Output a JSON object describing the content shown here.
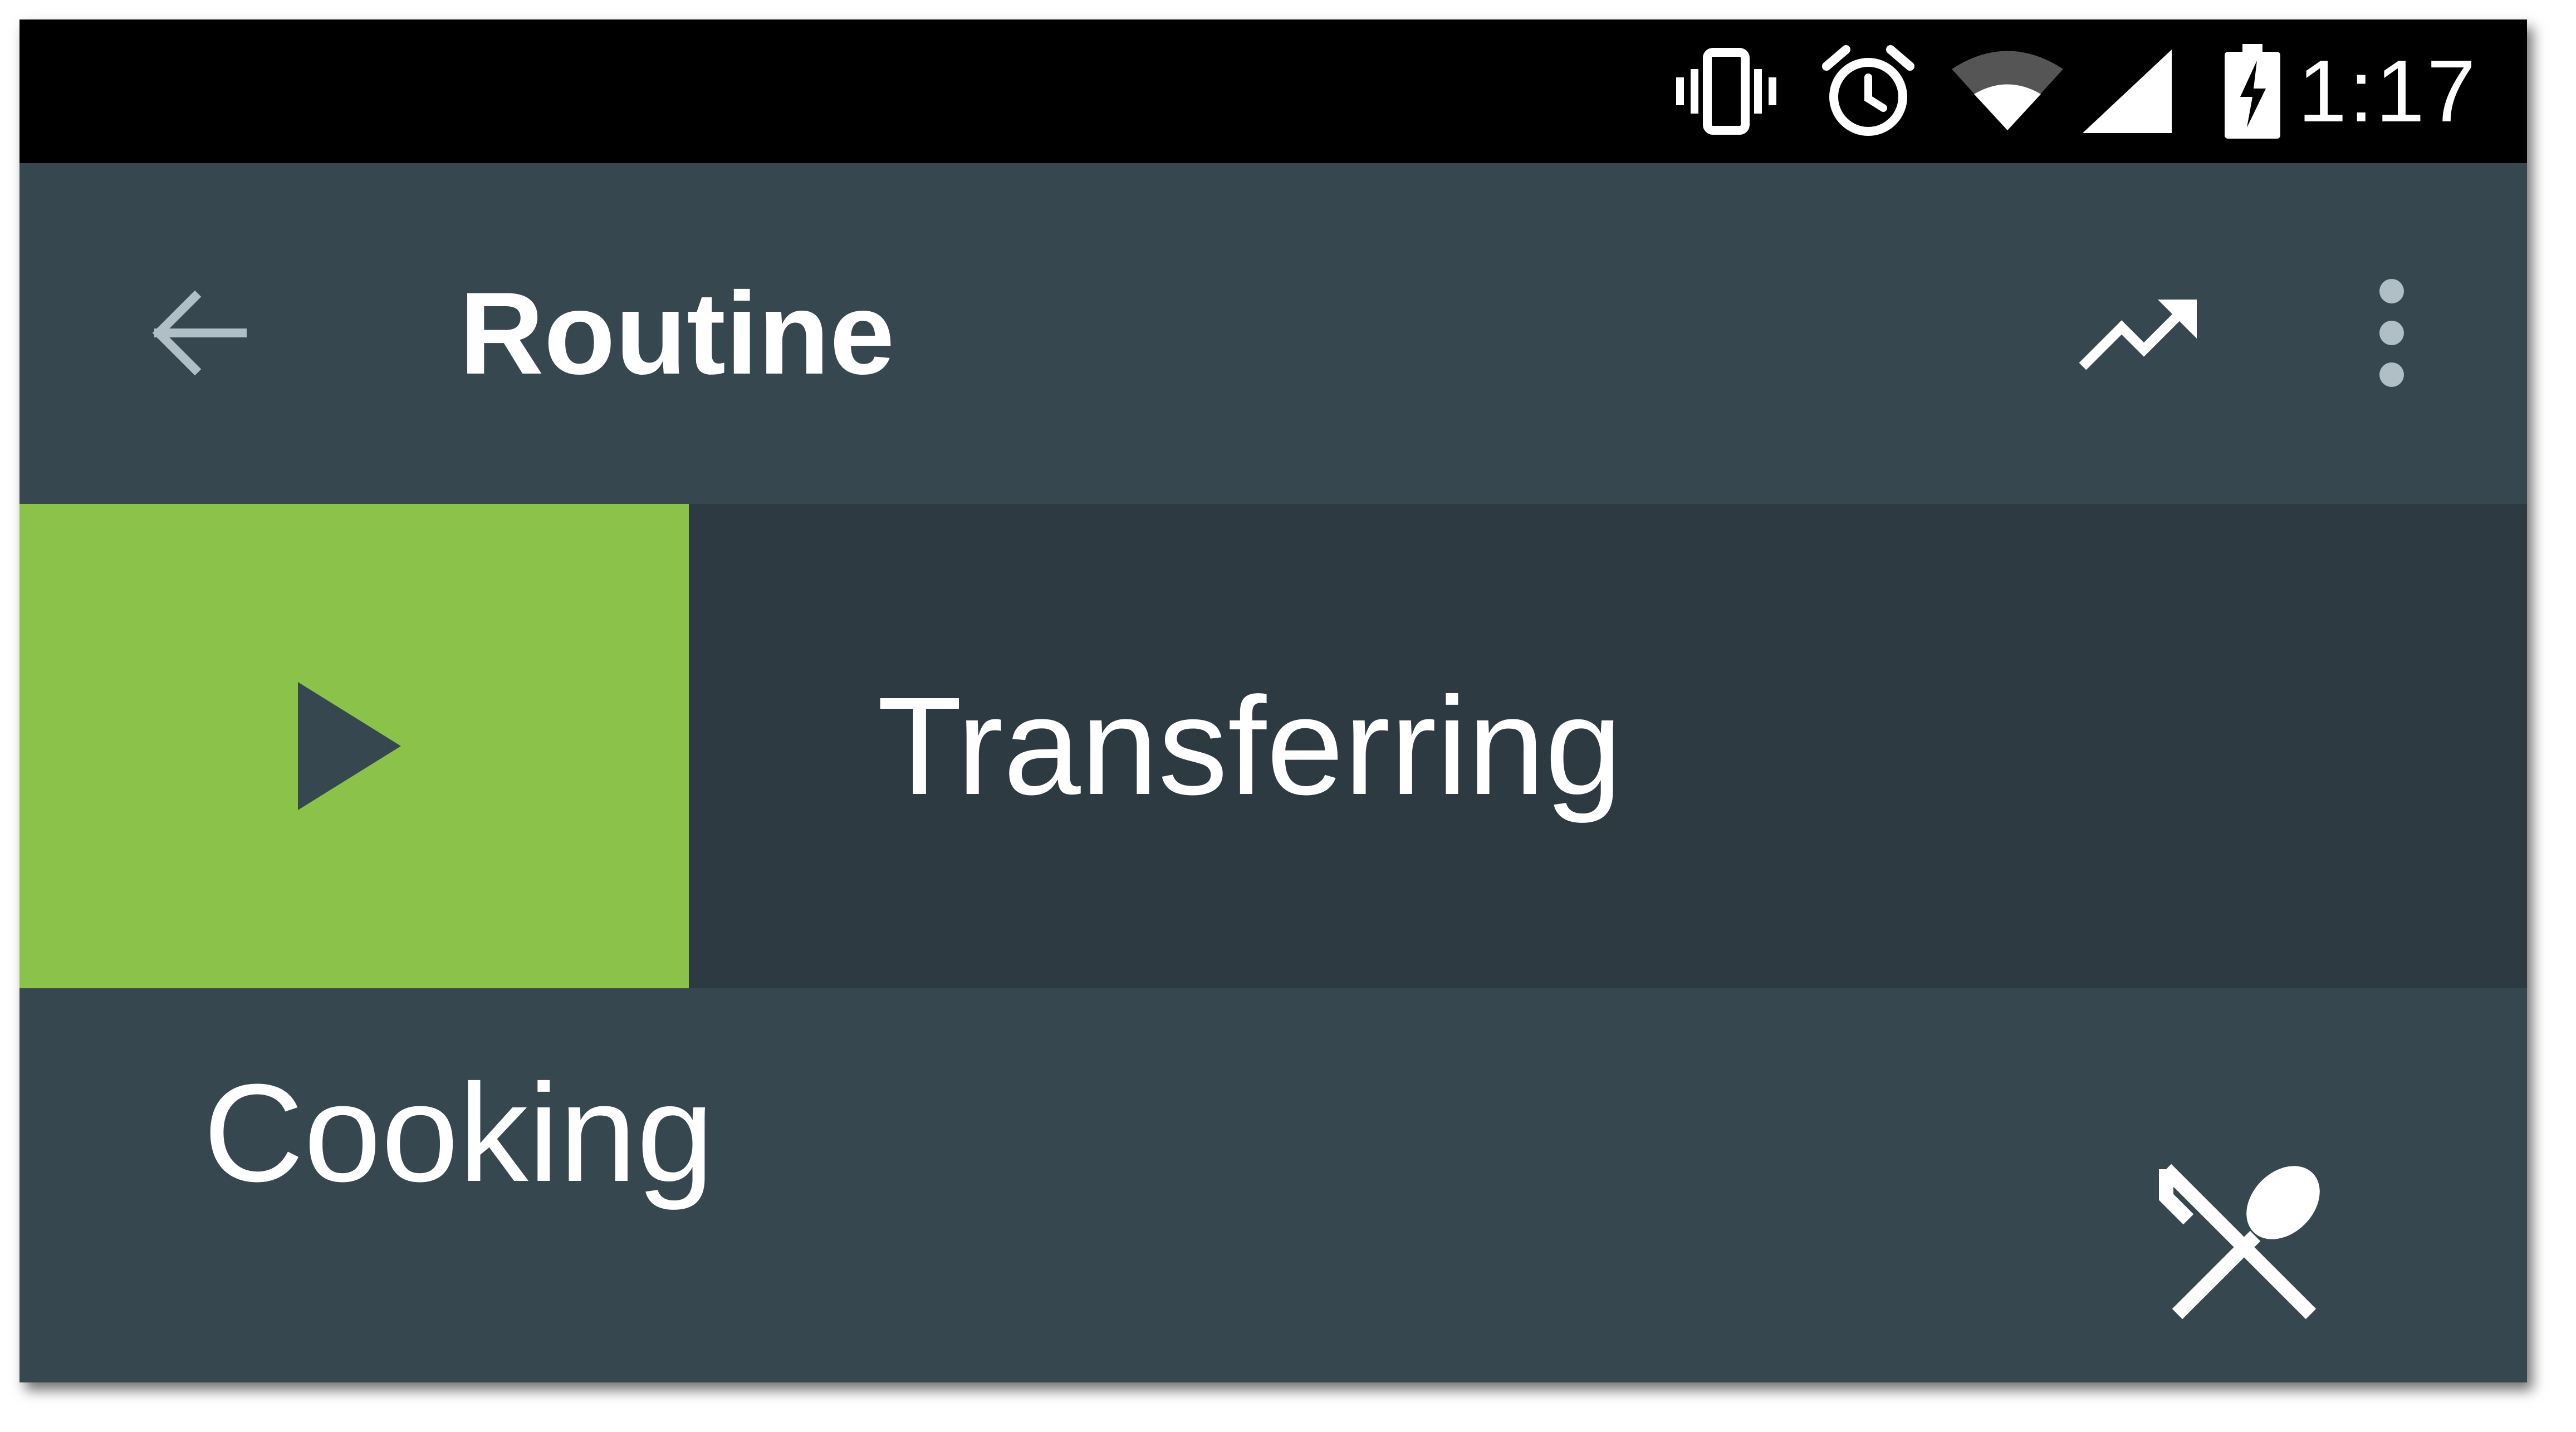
{
  "status_bar": {
    "time": "1:17",
    "icons": [
      "vibrate-icon",
      "alarm-icon",
      "wifi-icon",
      "signal-icon",
      "battery-charging-icon"
    ]
  },
  "toolbar": {
    "title": "Routine",
    "back_icon": "arrow-back-icon",
    "trend_icon": "trending-up-icon",
    "more_icon": "more-vert-icon"
  },
  "active_task": {
    "label": "Transferring",
    "action_icon": "play-icon",
    "accent_color": "#8bc34a"
  },
  "list": {
    "items": [
      {
        "label": "Cooking",
        "icon": "fork-spoon-icon"
      }
    ]
  },
  "colors": {
    "toolbar": "#37474f",
    "active_row": "#2e3a41",
    "status_bar": "#000000"
  }
}
